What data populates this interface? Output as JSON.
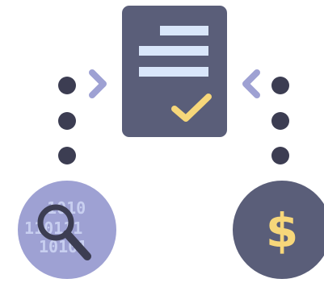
{
  "icons": {
    "document": "document-check-icon",
    "magnifier": "magnifying-glass-icon",
    "dollar": "dollar-coin-icon"
  },
  "binary_rows": [
    "1010",
    "110111",
    "10101"
  ],
  "dollar_symbol": "$",
  "colors": {
    "document_body": "#5a5e79",
    "document_lines": "#d9e6fa",
    "checkmark": "#f7d77a",
    "arrow": "#9ea1d3",
    "dots": "#3c3d52",
    "magnifier_circle": "#9ea1d3",
    "binary_digits": "#c8cff0",
    "magnifier_glass": "#3c3d52",
    "coin": "#5a5e79",
    "dollar": "#f7d77a"
  }
}
